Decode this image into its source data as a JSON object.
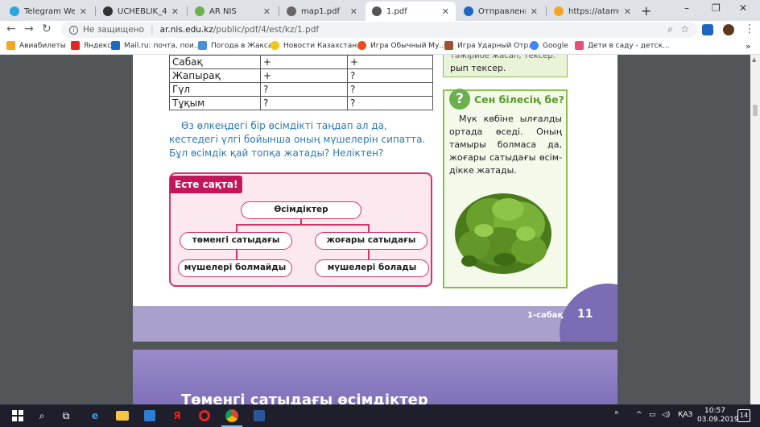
{
  "tabs": [
    {
      "title": "Telegram Web",
      "color": "#2ca5e0"
    },
    {
      "title": "UCHEBLIK_4 кл_К",
      "color": "#333333"
    },
    {
      "title": "AR NIS",
      "color": "#6ab04c"
    },
    {
      "title": "map1.pdf",
      "color": "#666666"
    },
    {
      "title": "1.pdf",
      "color": "#555555"
    },
    {
      "title": "Отправленные - ",
      "color": "#1e66c1"
    },
    {
      "title": "https://atamuraw",
      "color": "#f5a623"
    }
  ],
  "active_tab": 4,
  "window_controls": {
    "minimize": "–",
    "maximize": "❐",
    "close": "✕"
  },
  "address": {
    "insecure_label": "Не защищено",
    "host": "ar.nis.edu.kz",
    "path": "/public/pdf/4/est/kz/1.pdf"
  },
  "bookmarks": [
    {
      "label": "Авиабилеты",
      "color": "#f5a623"
    },
    {
      "label": "Яндекс",
      "color": "#e52620"
    },
    {
      "label": "Mail.ru: почта, пои...",
      "color": "#1e66c1"
    },
    {
      "label": "Погода в Жаксах",
      "color": "#4a90d9"
    },
    {
      "label": "Новости Казахстан...",
      "color": "#f5c518"
    },
    {
      "label": "Игра Обычный Му...",
      "color": "#e94e1b"
    },
    {
      "label": "Игра Ударный Отр...",
      "color": "#a0522d"
    },
    {
      "label": "Google",
      "color": "#4285f4"
    },
    {
      "label": "Дети в саду - детск...",
      "color": "#e94e77"
    }
  ],
  "table": {
    "rows": [
      [
        "Сабақ",
        "+",
        "+"
      ],
      [
        "Жапырақ",
        "+",
        "?"
      ],
      [
        "Гүл",
        "?",
        "?"
      ],
      [
        "Тұқым",
        "?",
        "?"
      ]
    ]
  },
  "instruction": "Өз өлкеңдегі бір өсімдікті таңдап ал да, кестедегі үлгі бойынша оның мүшелерін сипатта. Бұл өсімдік қай топқа жатады? Неліктен?",
  "remember": {
    "label": "Есте сақта!",
    "root": "Өсімдіктер",
    "left": "төменгі сатыдағы",
    "right": "жоғары сатыдағы",
    "left_child": "мүшелері болмайды",
    "right_child": "мүшелері болады"
  },
  "green_top": {
    "line1": "тәжірибе жасап, тексер.",
    "line2": "рып тексер."
  },
  "did_you_know": {
    "title": "Сен білесің бе?",
    "text": "Мүк көбіне ылғалды ортада өседі. Оның тамыры болмаса да, жоғары сатыдағы өсім­дікке жатады."
  },
  "footer": {
    "lesson": "1-сабақ",
    "page": "11"
  },
  "next_page_title": "Төменгі сатыдағы өсімдіктер",
  "taskbar": {
    "tray_arrow": "ᴿ",
    "language": "ҚАЗ",
    "time": "10:57",
    "date": "03.09.2019",
    "notifications": "14"
  }
}
